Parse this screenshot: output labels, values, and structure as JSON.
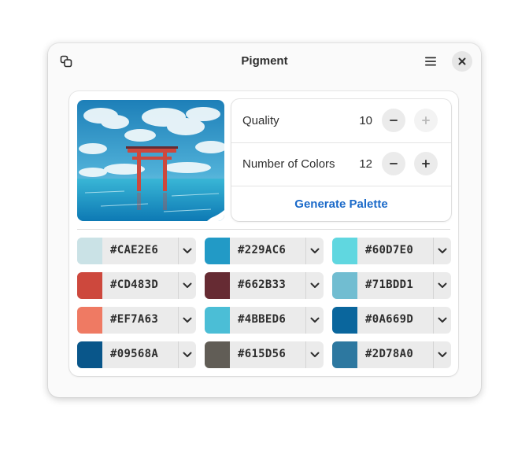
{
  "window": {
    "title": "Pigment"
  },
  "icons": {
    "copy": "copy-icon",
    "menu": "hamburger-menu-icon",
    "close": "close-icon",
    "minus": "minus-icon",
    "plus": "plus-icon",
    "dropdown": "chevron-down-icon"
  },
  "settings": {
    "quality_label": "Quality",
    "quality_value": "10",
    "colors_label": "Number of Colors",
    "colors_value": "12",
    "generate_label": "Generate Palette"
  },
  "palette": [
    {
      "hex": "#CAE2E6",
      "color": "#CAE2E6"
    },
    {
      "hex": "#229AC6",
      "color": "#229AC6"
    },
    {
      "hex": "#60D7E0",
      "color": "#60D7E0"
    },
    {
      "hex": "#CD483D",
      "color": "#CD483D"
    },
    {
      "hex": "#662B33",
      "color": "#662B33"
    },
    {
      "hex": "#71BDD1",
      "color": "#71BDD1"
    },
    {
      "hex": "#EF7A63",
      "color": "#EF7A63"
    },
    {
      "hex": "#4BBED6",
      "color": "#4BBED6"
    },
    {
      "hex": "#0A669D",
      "color": "#0A669D"
    },
    {
      "hex": "#09568A",
      "color": "#09568A"
    },
    {
      "hex": "#615D56",
      "color": "#615D56"
    },
    {
      "hex": "#2D78A0",
      "color": "#2D78A0"
    }
  ]
}
